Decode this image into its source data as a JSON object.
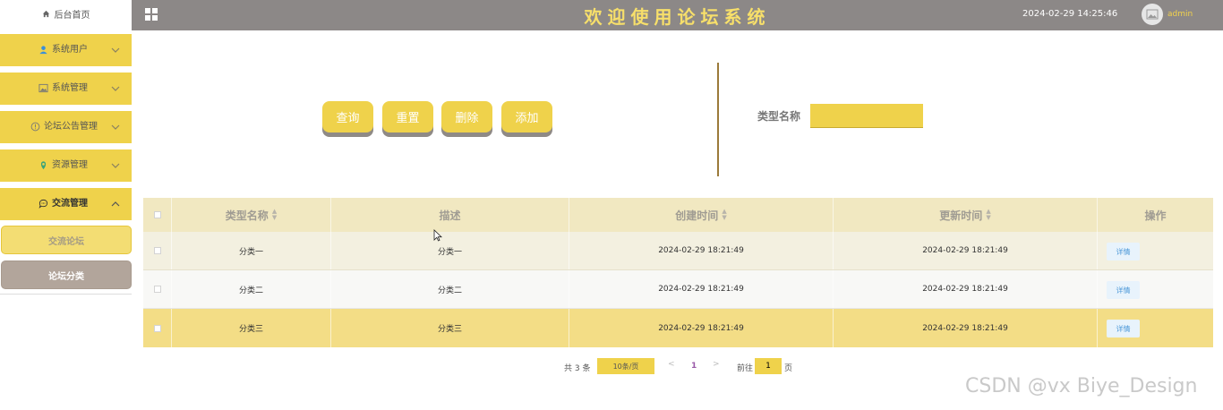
{
  "header": {
    "title": "欢迎使用论坛系统",
    "datetime": "2024-02-29 14:25:46",
    "username": "admin"
  },
  "sidebar": {
    "home": "后台首页",
    "menus": [
      {
        "label": "系统用户",
        "icon": "user-icon"
      },
      {
        "label": "系统管理",
        "icon": "image-icon"
      },
      {
        "label": "论坛公告管理",
        "icon": "info-circle-icon"
      },
      {
        "label": "资源管理",
        "icon": "location-pin-icon"
      },
      {
        "label": "交流管理",
        "icon": "chat-icon"
      }
    ],
    "submenu": [
      "交流论坛",
      "论坛分类"
    ]
  },
  "toolbar": {
    "query": "查询",
    "reset": "重置",
    "delete": "删除",
    "add": "添加",
    "filter_label": "类型名称",
    "filter_value": ""
  },
  "table": {
    "headers": [
      "类型名称",
      "描述",
      "创建时间",
      "更新时间",
      "操作"
    ],
    "rows": [
      {
        "name": "分类一",
        "desc": "分类一",
        "created": "2024-02-29 18:21:49",
        "updated": "2024-02-29 18:21:49",
        "action": "详情"
      },
      {
        "name": "分类二",
        "desc": "分类二",
        "created": "2024-02-29 18:21:49",
        "updated": "2024-02-29 18:21:49",
        "action": "详情"
      },
      {
        "name": "分类三",
        "desc": "分类三",
        "created": "2024-02-29 18:21:49",
        "updated": "2024-02-29 18:21:49",
        "action": "详情"
      }
    ]
  },
  "pagination": {
    "total": "共 3 条",
    "page_size": "10条/页",
    "prev": "<",
    "current": "1",
    "next": ">",
    "goto": "前往",
    "goto_value": "1",
    "page_suffix": "页"
  },
  "watermark": "CSDN @vx  Biye_Design",
  "colors": {
    "accent": "#efd24b",
    "header_bg": "#8c8887",
    "title": "#f7df6a",
    "active_sub": "#b2a59b"
  }
}
